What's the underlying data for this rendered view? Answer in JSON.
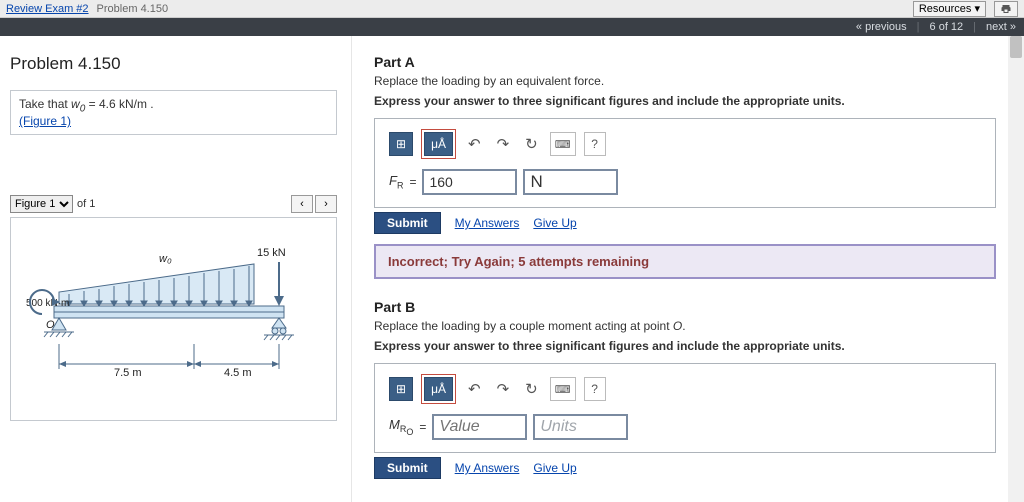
{
  "breadcrumb": {
    "exam": "Review Exam #2",
    "problem": "Problem 4.150"
  },
  "topbar": {
    "resources": "Resources",
    "print_icon": "print"
  },
  "nav": {
    "prev": "« previous",
    "pos": "6 of 12",
    "next": "next »"
  },
  "left": {
    "title": "Problem 4.150",
    "statement_prefix": "Take that ",
    "statement_var": "w",
    "statement_sub": "0",
    "statement_eq": " = 4.6 ",
    "statement_unit": "kN/m",
    "statement_suffix": " .",
    "figure_link": "(Figure 1)",
    "figselect": "Figure 1",
    "figof": "of 1",
    "figprev": "‹",
    "fignext": "›",
    "figure": {
      "w0": "w₀",
      "force_label": "15 kN",
      "moment_label": "500 kN·m",
      "origin": "O",
      "dim1": "7.5 m",
      "dim2": "4.5 m"
    }
  },
  "partA": {
    "title": "Part A",
    "desc": "Replace the loading by an equivalent force.",
    "instr": "Express your answer to three significant figures and include the appropriate units.",
    "toolbar": {
      "templates": "⊞",
      "symbols": "μÅ",
      "undo": "↶",
      "redo": "↷",
      "reset": "↻",
      "keyboard": "⌨",
      "help": "?"
    },
    "var_html": "F_R",
    "eq": "=",
    "value": "160",
    "units": "N",
    "submit": "Submit",
    "myanswers": "My Answers",
    "giveup": "Give Up",
    "feedback": "Incorrect; Try Again; 5 attempts remaining"
  },
  "partB": {
    "title": "Part B",
    "desc_prefix": "Replace the loading by a couple moment acting at point ",
    "desc_point": "O",
    "desc_suffix": ".",
    "instr": "Express your answer to three significant figures and include the appropriate units.",
    "toolbar": {
      "templates": "⊞",
      "symbols": "μÅ",
      "undo": "↶",
      "redo": "↷",
      "reset": "↻",
      "keyboard": "⌨",
      "help": "?"
    },
    "var_html": "M_Ro",
    "eq": "=",
    "value_placeholder": "Value",
    "units_placeholder": "Units",
    "submit": "Submit",
    "myanswers": "My Answers",
    "giveup": "Give Up"
  }
}
